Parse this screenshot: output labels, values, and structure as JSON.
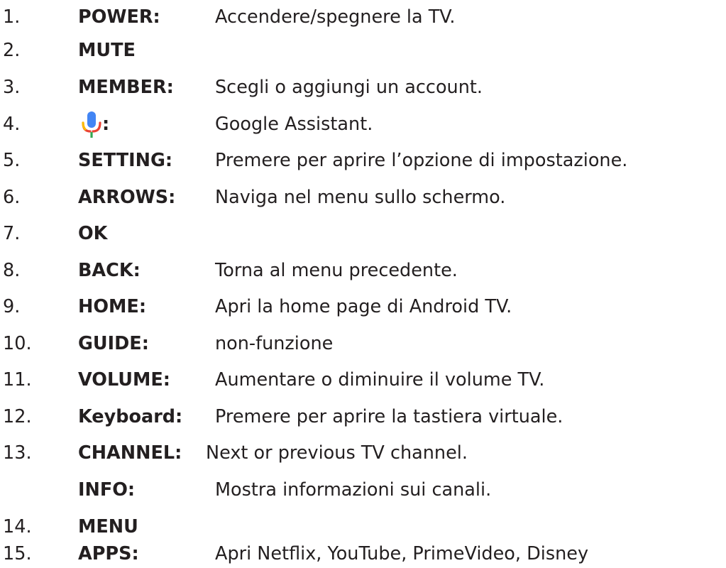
{
  "colors": {
    "text": "#231f20",
    "google_blue": "#4285f4",
    "google_red": "#ea4335",
    "google_yellow": "#fbbc04",
    "google_green": "#34a853"
  },
  "items": [
    {
      "number": "1.",
      "label": "POWER:",
      "description": "Accendere/spegnere la TV."
    },
    {
      "number": "2.",
      "label": "MUTE",
      "description": ""
    },
    {
      "number": "3.",
      "label": "MEMBER:",
      "description": "Scegli o aggiungi un account."
    },
    {
      "number": "4.",
      "label": ":",
      "icon": "google-assistant-mic-icon",
      "description": "Google Assistant."
    },
    {
      "number": "5.",
      "label": "SETTING:",
      "description": "Premere per aprire l’opzione di impostazione."
    },
    {
      "number": "6.",
      "label": "ARROWS:",
      "description": "Naviga nel menu sullo schermo."
    },
    {
      "number": "7.",
      "label": "OK",
      "description": ""
    },
    {
      "number": "8.",
      "label": "BACK:",
      "description": "Torna al menu precedente."
    },
    {
      "number": "9.",
      "label": "HOME:",
      "description": "Apri la home page di Android TV."
    },
    {
      "number": "10.",
      "label": "GUIDE:",
      "description": "non-funzione"
    },
    {
      "number": "11.",
      "label": "VOLUME:",
      "description": "Aumentare o diminuire il volume TV."
    },
    {
      "number": "12.",
      "label": "Keyboard:",
      "description": "Premere per aprire la tastiera virtuale."
    },
    {
      "number": "13.",
      "label": "CHANNEL:",
      "description": "Next or previous TV channel."
    },
    {
      "number": "",
      "label": "INFO:",
      "description": "Mostra informazioni sui canali."
    },
    {
      "number": "14.",
      "label": "MENU",
      "description": ""
    },
    {
      "number": "15.",
      "label": "APPS:",
      "description": "Apri Netflix, YouTube, PrimeVideo, Disney"
    }
  ]
}
